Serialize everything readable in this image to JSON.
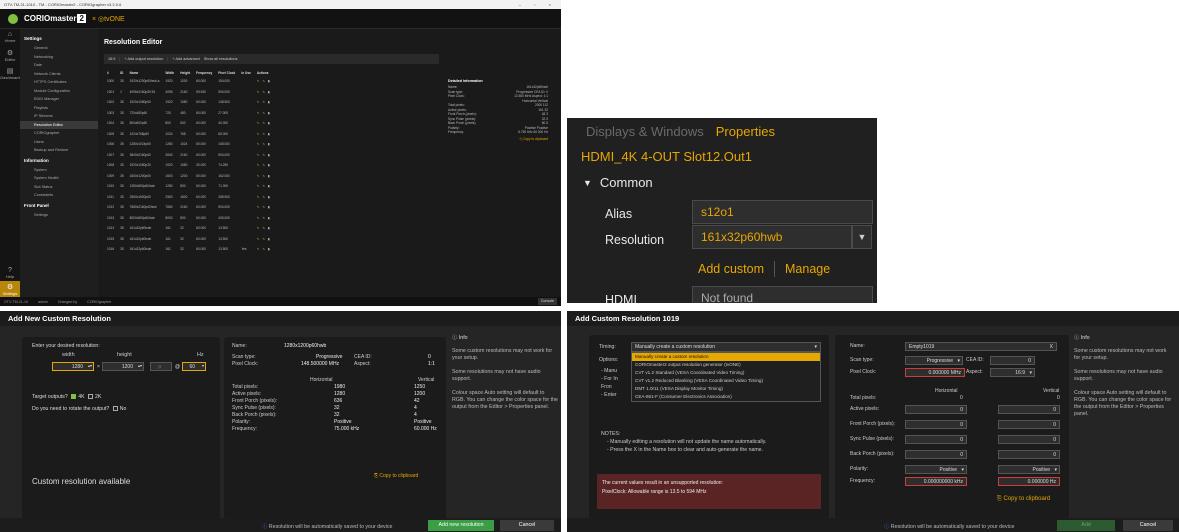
{
  "app": {
    "window_title": "OTV-TM-21-1010 - TM - CORIOmaster2 - CORIOgrapher v3.2.0.6",
    "brand": "CORIO",
    "brand_bold": "master",
    "brand_num": "2",
    "by": "tvONE",
    "rail": [
      {
        "icon": "home-icon",
        "label": "Home"
      },
      {
        "icon": "gear-icon",
        "label": "Editor"
      },
      {
        "icon": "dashboard-icon",
        "label": "Dashboard"
      }
    ],
    "rail_bottom": [
      {
        "icon": "help-icon",
        "label": "Help"
      },
      {
        "icon": "gear-icon",
        "label": "Settings"
      }
    ],
    "nav": [
      {
        "type": "section",
        "label": "Settings"
      },
      {
        "type": "item",
        "label": "General"
      },
      {
        "type": "item",
        "label": "Networking"
      },
      {
        "type": "item",
        "label": "Date"
      },
      {
        "type": "item",
        "label": "Network Clients"
      },
      {
        "type": "item",
        "label": "HTTPS Certificates"
      },
      {
        "type": "item",
        "label": "Module Configuration"
      },
      {
        "type": "item",
        "label": "EDID Manager"
      },
      {
        "type": "item",
        "label": "Playlists"
      },
      {
        "type": "item",
        "label": "IP Streams"
      },
      {
        "type": "item",
        "label": "Resolution Editor",
        "selected": true
      },
      {
        "type": "item",
        "label": "CORIOgrapher"
      },
      {
        "type": "item",
        "label": "Users"
      },
      {
        "type": "item",
        "label": "Backup and Restore"
      },
      {
        "type": "section",
        "label": "Information"
      },
      {
        "type": "item",
        "label": "System"
      },
      {
        "type": "item",
        "label": "System Health"
      },
      {
        "type": "item",
        "label": "Slot Status"
      },
      {
        "type": "item",
        "label": "Constraints"
      },
      {
        "type": "section",
        "label": "Front Panel"
      },
      {
        "type": "item",
        "label": "Settings"
      }
    ],
    "page_title": "Resolution Editor",
    "toolbar": [
      "16:9",
      "Add output resolution",
      "Add advanced",
      "Show all resolutions"
    ],
    "table_headers": [
      "#",
      "ID",
      "Name",
      "Width",
      "Height",
      "Frequency",
      "Pixel Clock",
      "In Use",
      "Actions"
    ],
    "rows": [
      [
        "1000",
        "35",
        "1920x1200p60hwb-a",
        "1920",
        "1200",
        "60.000",
        "154.000",
        ""
      ],
      [
        "1001",
        "1",
        "4096x2160p59.94",
        "4096",
        "2160",
        "59.940",
        "594.000",
        ""
      ],
      [
        "1002",
        "35",
        "1920x1080p60",
        "1920",
        "1080",
        "60.000",
        "148.500",
        ""
      ],
      [
        "1003",
        "35",
        "720x480p60",
        "720",
        "480",
        "60.000",
        "27.000",
        ""
      ],
      [
        "1004",
        "35",
        "800x600p60",
        "800",
        "600",
        "60.000",
        "40.000",
        ""
      ],
      [
        "1005",
        "35",
        "1024x768p60",
        "1024",
        "768",
        "60.000",
        "65.000",
        ""
      ],
      [
        "1006",
        "35",
        "1280x1024p60",
        "1280",
        "1024",
        "60.000",
        "108.000",
        ""
      ],
      [
        "1007",
        "35",
        "3840x2160p60",
        "3840",
        "2160",
        "60.000",
        "594.000",
        ""
      ],
      [
        "1008",
        "35",
        "1920x1080p30",
        "1920",
        "1080",
        "30.000",
        "74.250",
        ""
      ],
      [
        "1009",
        "35",
        "1600x1200p60",
        "1600",
        "1200",
        "60.000",
        "162.000",
        ""
      ],
      [
        "1010",
        "35",
        "1280x800p60hwb",
        "1280",
        "800",
        "60.000",
        "71.000",
        ""
      ],
      [
        "1011",
        "35",
        "2560x1600p60",
        "2560",
        "1600",
        "60.000",
        "268.500",
        ""
      ],
      [
        "1012",
        "35",
        "7680x2160p60hwb",
        "7680",
        "2160",
        "60.000",
        "594.000",
        ""
      ],
      [
        "1013",
        "35",
        "8000x800p60hwb",
        "8000",
        "800",
        "60.000",
        "405.000",
        ""
      ],
      [
        "1014",
        "35",
        "161x32p60hwb",
        "161",
        "32",
        "60.000",
        "13.500",
        ""
      ],
      [
        "1015",
        "35",
        "161x32p60hwb",
        "161",
        "32",
        "60.000",
        "13.500",
        ""
      ],
      [
        "1016",
        "35",
        "161x32p60hwb",
        "161",
        "32",
        "60.000",
        "13.500",
        "Yes"
      ]
    ],
    "detail": {
      "title": "Detailed information",
      "lines": [
        [
          "Name:",
          "161x32p60hwb"
        ],
        [
          "Scan type:",
          "Progressive  CEA ID: 0"
        ],
        [
          "Pixel Clock:",
          "13.500 MHz  Aspect: 1:1"
        ],
        [
          "",
          "Horizontal   Vertical"
        ],
        [
          "Total pixels:",
          "2000   112"
        ],
        [
          "Active pixels:",
          "161   32"
        ],
        [
          "Front Porch (pixels):",
          "48   3"
        ],
        [
          "Sync Pulse (pixels):",
          "32   5"
        ],
        [
          "Back Porch (pixels):",
          "80   6"
        ],
        [
          "Polarity:",
          "Positive   Positive"
        ],
        [
          "Frequency:",
          "6.750 kHz   60.000 Hz"
        ]
      ],
      "copy": "Copy to clipboard"
    },
    "status": [
      "OTV-TM-21-10",
      "admin",
      "Changed by",
      "CORIOgrapher"
    ],
    "console": "Console"
  },
  "props": {
    "tab1": "Displays & Windows",
    "tab2": "Properties",
    "output_name": "HDMI_4K 4-OUT Slot12.Out1",
    "section": "Common",
    "alias_label": "Alias",
    "alias_value": "s12o1",
    "resolution_label": "Resolution",
    "resolution_value": "161x32p60hwb",
    "add_custom": "Add custom",
    "manage": "Manage",
    "hdmi_label": "HDMI",
    "hdmi_value": "Not found"
  },
  "dlg1": {
    "title": "Add New Custom Resolution",
    "enter_label": "Enter your desired resolution:",
    "width_label": "width",
    "height_label": "height",
    "hz_label": "Hz",
    "width": "1280",
    "height": "1200",
    "p": "p",
    "hz": "60",
    "target_label": "Target outputs?",
    "target_4k": "4K",
    "target_2k": "2K",
    "rotate_label": "Do you need to rotate the output?",
    "rotate_no": "No",
    "available": "Custom resolution available",
    "name_label": "Name:",
    "name_value": "1280x1200p60hwb",
    "scan_label": "Scan type:",
    "scan_value": "Progressive",
    "cea_label": "CEA ID:",
    "cea_value": "0",
    "pclk_label": "Pixel Clock:",
    "pclk_value": "148.500000 MHz",
    "aspect_label": "Aspect:",
    "aspect_value": "1:1",
    "horizontal": "Horizontal",
    "vertical": "Vertical",
    "params": [
      {
        "label": "Total pixels:",
        "h": "1980",
        "v": "1250"
      },
      {
        "label": "Active pixels:",
        "h": "1280",
        "v": "1200"
      },
      {
        "label": "Front Porch (pixels):",
        "h": "636",
        "v": "42"
      },
      {
        "label": "Sync Pulse (pixels):",
        "h": "32",
        "v": "4"
      },
      {
        "label": "Back Porch (pixels):",
        "h": "32",
        "v": "4"
      },
      {
        "label": "Polarity:",
        "h": "Positive",
        "v": "Positive"
      },
      {
        "label": "Frequency:",
        "h": "75.000 kHz",
        "v": "60.000 Hz"
      }
    ],
    "copy": "Copy to clipboard",
    "info_title": "Info",
    "info": [
      "Some custom resolutions may not work for your setup.",
      "Some resolutions may not have audio support.",
      "Colour space Auto setting will default to RGB. You can change the color space for the output from the Editor > Properties panel."
    ],
    "footer_note": "Resolution will be automatically saved to your device",
    "add_button": "Add new resolution",
    "cancel_button": "Cancel"
  },
  "dlg2": {
    "title": "Add Custom Resolution 1019",
    "timing_label": "Timing:",
    "timing_value": "Manually create a custom resolution",
    "options_label": "Options:",
    "dd_options": [
      "Manually create a custom resolution",
      "CORIOmaster2 output resolution generator (tvONE)",
      "CVT v1.2 Standard (VESA Coordinated Video Timing)",
      "CVT v1.2 Reduced Blanking (VESA Coordinated Video Timing)",
      "DMT 1.0r11 (VESA Display Monitor Timing)",
      "CEA-861-F (Consumer Electronics Association)"
    ],
    "option_lines": [
      "- Manu",
      "- For In",
      "  Fron",
      "- Enter"
    ],
    "notes_title": "NOTES:",
    "notes": [
      "- Manually editing a resolution will not update the name automatically.",
      "- Press the X in the Name box to clear and auto-generate the name."
    ],
    "err1": "The current values result in an unsupported resolution:",
    "err2": "PixelClock: Allowable range is 13.5 to 594 MHz",
    "name_label": "Name:",
    "name_value": "Empty1019",
    "clear_icon": "X",
    "scan_label": "Scan type:",
    "scan_value": "Progressive",
    "cea_label": "CEA ID:",
    "cea_value": "0",
    "pclk_label": "Pixel Clock:",
    "pclk_value": "0.000000 MHz",
    "aspect_label": "Aspect:",
    "aspect_value": "16:9",
    "horizontal": "Horizontal",
    "vertical": "Vertical",
    "total_label": "Total pixels:",
    "total_h": "0",
    "total_v": "0",
    "params": [
      {
        "label": "Active pixels:",
        "h": "0",
        "v": "0"
      },
      {
        "label": "Front Porch (pixels):",
        "h": "0",
        "v": "0"
      },
      {
        "label": "Sync Pulse (pixels):",
        "h": "0",
        "v": "0"
      },
      {
        "label": "Back Porch (pixels):",
        "h": "0",
        "v": "0"
      }
    ],
    "polarity_label": "Polarity:",
    "polarity_h": "Positive",
    "polarity_v": "Positive",
    "freq_label": "Frequency:",
    "freq_h": "0.000000000 kHz",
    "freq_v": "0.000000 Hz",
    "copy": "Copy to clipboard",
    "info_title": "Info",
    "info": [
      "Some custom resolutions may not work for your setup.",
      "Some resolutions may not have audio support.",
      "Colour space Auto setting will default to RGB. You can change the color space for the output from the Editor > Properties panel."
    ],
    "footer_note": "Resolution will be automatically saved to your device",
    "add_button": "Add",
    "cancel_button": "Cancel"
  }
}
